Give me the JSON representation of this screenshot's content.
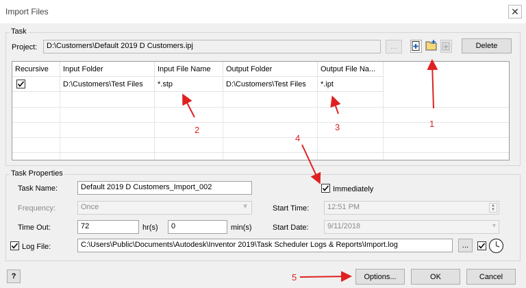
{
  "window": {
    "title": "Import Files",
    "close_glyph": "✕"
  },
  "task_group": {
    "label": "Task",
    "project_label": "Project:",
    "project_value": "D:\\Customers\\Default 2019 D Customers.ipj",
    "browse_label": "...",
    "icons": [
      "new-task-icon",
      "add-folder-icon",
      "add-files-icon"
    ],
    "delete_label": "Delete",
    "table": {
      "columns": [
        "Recursive",
        "Input Folder",
        "Input File Name",
        "Output Folder",
        "Output File Na..."
      ],
      "rows": [
        {
          "recursive": true,
          "input_folder": "D:\\Customers\\Test Files",
          "input_file": "*.stp",
          "output_folder": "D:\\Customers\\Test Files",
          "output_file": "*.ipt"
        }
      ]
    }
  },
  "properties": {
    "label": "Task Properties",
    "task_name_label": "Task Name:",
    "task_name_value": "Default 2019 D Customers_Import_002",
    "immediately_label": "Immediately",
    "immediately_checked": true,
    "frequency_label": "Frequency:",
    "frequency_value": "Once",
    "start_time_label": "Start Time:",
    "start_time_value": "12:51 PM",
    "timeout_label": "Time Out:",
    "timeout_hr_value": "72",
    "hr_label": "hr(s)",
    "timeout_min_value": "0",
    "min_label": "min(s)",
    "start_date_label": "Start Date:",
    "start_date_value": "9/11/2018",
    "logfile_label": "Log File:",
    "logfile_checked": true,
    "logfile_value": "C:\\Users\\Public\\Documents\\Autodesk\\Inventor 2019\\Task Scheduler Logs & Reports\\Import.log",
    "logfile_browse": "..."
  },
  "footer": {
    "help_glyph": "?",
    "options_label": "Options...",
    "ok_label": "OK",
    "cancel_label": "Cancel"
  },
  "annotations": {
    "n1": "1",
    "n2": "2",
    "n3": "3",
    "n4": "4",
    "n5": "5",
    "color": "#e02020"
  }
}
